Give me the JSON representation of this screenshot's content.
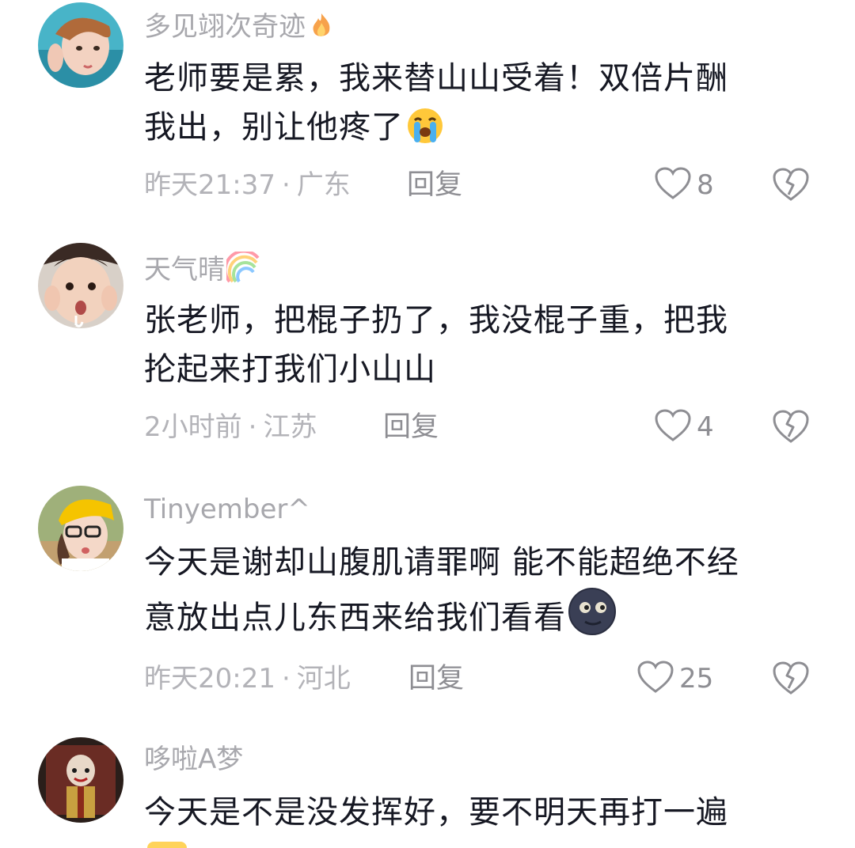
{
  "comments": [
    {
      "username": "多见翊次奇迹",
      "username_emoji": "fire-icon",
      "text_lines": [
        "老师要是累，我来替山山受着！双倍片酬",
        "我出，别让他疼了"
      ],
      "text_emoji": "loudly-crying-face-icon",
      "time": "昨天21:37",
      "location": "广东",
      "reply_label": "回复",
      "likes": "8"
    },
    {
      "username": "天气晴",
      "username_emoji": "rainbow-icon",
      "text_lines": [
        "张老师，把棍子扔了，我没棍子重，把我",
        "抡起来打我们小山山"
      ],
      "text_emoji": "",
      "time": "2小时前",
      "location": "江苏",
      "reply_label": "回复",
      "likes": "4"
    },
    {
      "username": "Tinyember^",
      "username_emoji": "",
      "text_lines": [
        "今天是谢却山腹肌请罪啊 能不能超绝不经",
        "意放出点儿东西来给我们看看"
      ],
      "text_emoji": "new-moon-face-icon",
      "time": "昨天20:21",
      "location": "河北",
      "reply_label": "回复",
      "likes": "25"
    },
    {
      "username": "哆啦A梦",
      "username_emoji": "",
      "text_lines": [
        "今天是不是没发挥好，要不明天再打一遍"
      ],
      "text_emoji": "",
      "time": "",
      "location": "",
      "reply_label": "",
      "likes": ""
    }
  ],
  "colors": {
    "text_primary": "#161823",
    "text_secondary": "#a8a8ad",
    "icon_gray": "#8e8e93"
  }
}
